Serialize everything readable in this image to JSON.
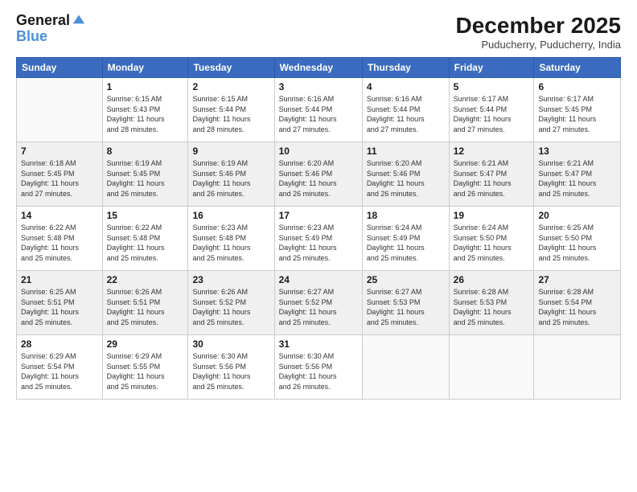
{
  "logo": {
    "line1": "General",
    "line2": "Blue"
  },
  "title": "December 2025",
  "location": "Puducherry, Puducherry, India",
  "days_header": [
    "Sunday",
    "Monday",
    "Tuesday",
    "Wednesday",
    "Thursday",
    "Friday",
    "Saturday"
  ],
  "weeks": [
    {
      "shaded": false,
      "days": [
        {
          "num": "",
          "info": ""
        },
        {
          "num": "1",
          "info": "Sunrise: 6:15 AM\nSunset: 5:43 PM\nDaylight: 11 hours\nand 28 minutes."
        },
        {
          "num": "2",
          "info": "Sunrise: 6:15 AM\nSunset: 5:44 PM\nDaylight: 11 hours\nand 28 minutes."
        },
        {
          "num": "3",
          "info": "Sunrise: 6:16 AM\nSunset: 5:44 PM\nDaylight: 11 hours\nand 27 minutes."
        },
        {
          "num": "4",
          "info": "Sunrise: 6:16 AM\nSunset: 5:44 PM\nDaylight: 11 hours\nand 27 minutes."
        },
        {
          "num": "5",
          "info": "Sunrise: 6:17 AM\nSunset: 5:44 PM\nDaylight: 11 hours\nand 27 minutes."
        },
        {
          "num": "6",
          "info": "Sunrise: 6:17 AM\nSunset: 5:45 PM\nDaylight: 11 hours\nand 27 minutes."
        }
      ]
    },
    {
      "shaded": true,
      "days": [
        {
          "num": "7",
          "info": "Sunrise: 6:18 AM\nSunset: 5:45 PM\nDaylight: 11 hours\nand 27 minutes."
        },
        {
          "num": "8",
          "info": "Sunrise: 6:19 AM\nSunset: 5:45 PM\nDaylight: 11 hours\nand 26 minutes."
        },
        {
          "num": "9",
          "info": "Sunrise: 6:19 AM\nSunset: 5:46 PM\nDaylight: 11 hours\nand 26 minutes."
        },
        {
          "num": "10",
          "info": "Sunrise: 6:20 AM\nSunset: 5:46 PM\nDaylight: 11 hours\nand 26 minutes."
        },
        {
          "num": "11",
          "info": "Sunrise: 6:20 AM\nSunset: 5:46 PM\nDaylight: 11 hours\nand 26 minutes."
        },
        {
          "num": "12",
          "info": "Sunrise: 6:21 AM\nSunset: 5:47 PM\nDaylight: 11 hours\nand 26 minutes."
        },
        {
          "num": "13",
          "info": "Sunrise: 6:21 AM\nSunset: 5:47 PM\nDaylight: 11 hours\nand 25 minutes."
        }
      ]
    },
    {
      "shaded": false,
      "days": [
        {
          "num": "14",
          "info": "Sunrise: 6:22 AM\nSunset: 5:48 PM\nDaylight: 11 hours\nand 25 minutes."
        },
        {
          "num": "15",
          "info": "Sunrise: 6:22 AM\nSunset: 5:48 PM\nDaylight: 11 hours\nand 25 minutes."
        },
        {
          "num": "16",
          "info": "Sunrise: 6:23 AM\nSunset: 5:48 PM\nDaylight: 11 hours\nand 25 minutes."
        },
        {
          "num": "17",
          "info": "Sunrise: 6:23 AM\nSunset: 5:49 PM\nDaylight: 11 hours\nand 25 minutes."
        },
        {
          "num": "18",
          "info": "Sunrise: 6:24 AM\nSunset: 5:49 PM\nDaylight: 11 hours\nand 25 minutes."
        },
        {
          "num": "19",
          "info": "Sunrise: 6:24 AM\nSunset: 5:50 PM\nDaylight: 11 hours\nand 25 minutes."
        },
        {
          "num": "20",
          "info": "Sunrise: 6:25 AM\nSunset: 5:50 PM\nDaylight: 11 hours\nand 25 minutes."
        }
      ]
    },
    {
      "shaded": true,
      "days": [
        {
          "num": "21",
          "info": "Sunrise: 6:25 AM\nSunset: 5:51 PM\nDaylight: 11 hours\nand 25 minutes."
        },
        {
          "num": "22",
          "info": "Sunrise: 6:26 AM\nSunset: 5:51 PM\nDaylight: 11 hours\nand 25 minutes."
        },
        {
          "num": "23",
          "info": "Sunrise: 6:26 AM\nSunset: 5:52 PM\nDaylight: 11 hours\nand 25 minutes."
        },
        {
          "num": "24",
          "info": "Sunrise: 6:27 AM\nSunset: 5:52 PM\nDaylight: 11 hours\nand 25 minutes."
        },
        {
          "num": "25",
          "info": "Sunrise: 6:27 AM\nSunset: 5:53 PM\nDaylight: 11 hours\nand 25 minutes."
        },
        {
          "num": "26",
          "info": "Sunrise: 6:28 AM\nSunset: 5:53 PM\nDaylight: 11 hours\nand 25 minutes."
        },
        {
          "num": "27",
          "info": "Sunrise: 6:28 AM\nSunset: 5:54 PM\nDaylight: 11 hours\nand 25 minutes."
        }
      ]
    },
    {
      "shaded": false,
      "days": [
        {
          "num": "28",
          "info": "Sunrise: 6:29 AM\nSunset: 5:54 PM\nDaylight: 11 hours\nand 25 minutes."
        },
        {
          "num": "29",
          "info": "Sunrise: 6:29 AM\nSunset: 5:55 PM\nDaylight: 11 hours\nand 25 minutes."
        },
        {
          "num": "30",
          "info": "Sunrise: 6:30 AM\nSunset: 5:56 PM\nDaylight: 11 hours\nand 25 minutes."
        },
        {
          "num": "31",
          "info": "Sunrise: 6:30 AM\nSunset: 5:56 PM\nDaylight: 11 hours\nand 26 minutes."
        },
        {
          "num": "",
          "info": ""
        },
        {
          "num": "",
          "info": ""
        },
        {
          "num": "",
          "info": ""
        }
      ]
    }
  ]
}
